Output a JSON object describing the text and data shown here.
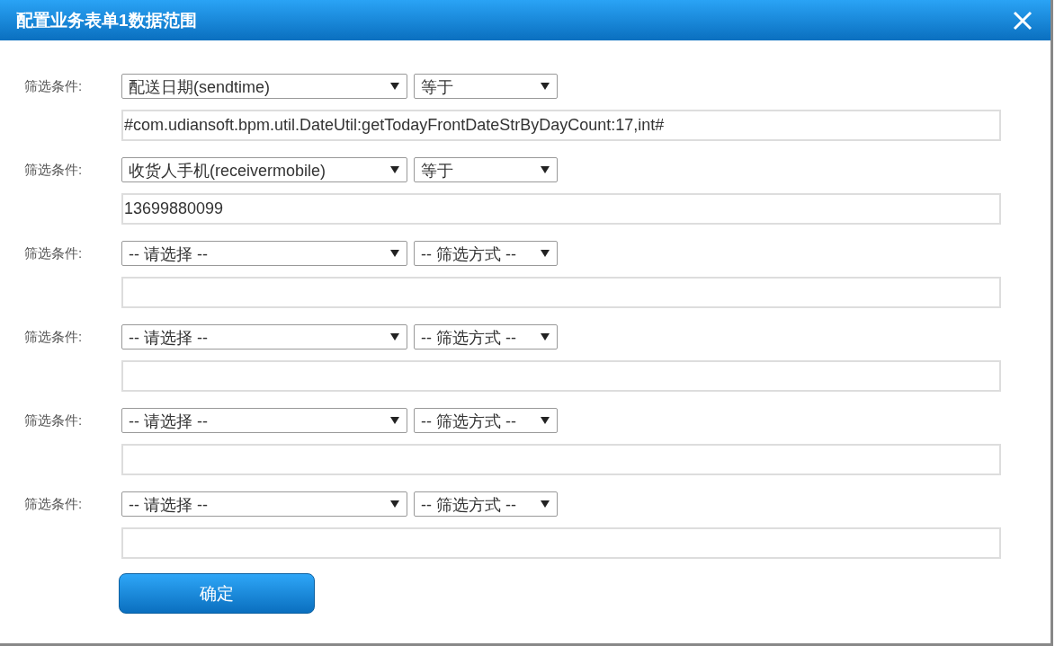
{
  "window": {
    "title": "配置业务表单1数据范围"
  },
  "conditions": [
    {
      "label": "筛选条件:",
      "field": "配送日期(sendtime)",
      "operator": "等于",
      "value": "#com.udiansoft.bpm.util.DateUtil:getTodayFrontDateStrByDayCount:17,int#"
    },
    {
      "label": "筛选条件:",
      "field": "收货人手机(receivermobile)",
      "operator": "等于",
      "value": "13699880099"
    },
    {
      "label": "筛选条件:",
      "field": "-- 请选择 --",
      "operator": "-- 筛选方式 --"
    },
    {
      "label": "筛选条件:",
      "field": "-- 请选择 --",
      "operator": "-- 筛选方式 --"
    },
    {
      "label": "筛选条件:",
      "field": "-- 请选择 --",
      "operator": "-- 筛选方式 --"
    },
    {
      "label": "筛选条件:",
      "field": "-- 请选择 --",
      "operator": "-- 筛选方式 --"
    }
  ],
  "buttons": [
    "确定"
  ]
}
